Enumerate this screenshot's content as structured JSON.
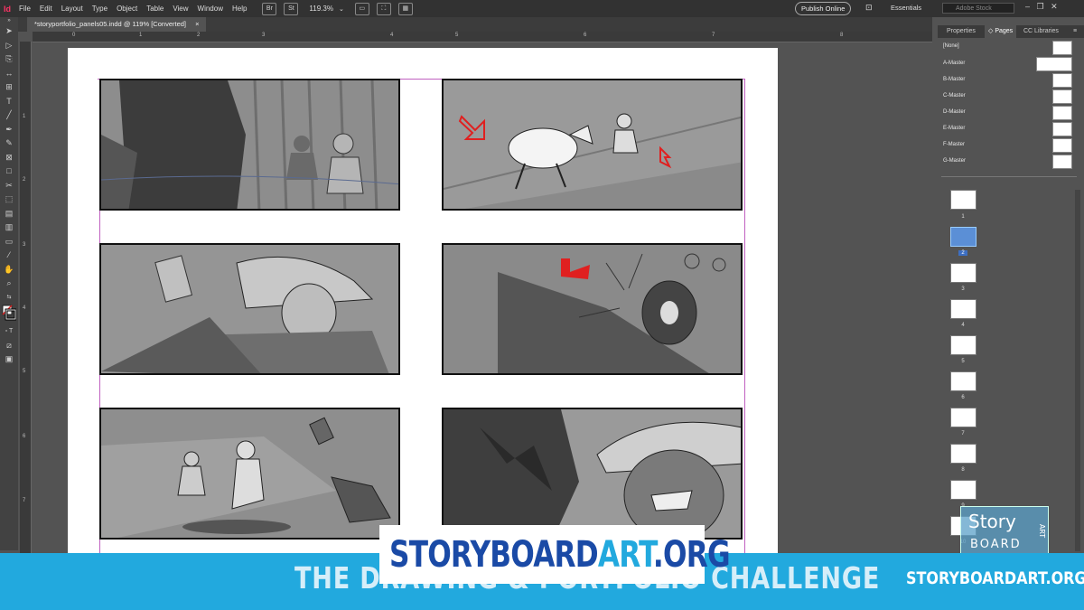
{
  "app": {
    "logo": "Id",
    "menu": [
      "File",
      "Edit",
      "Layout",
      "Type",
      "Object",
      "Table",
      "View",
      "Window",
      "Help"
    ],
    "bridge_icons": [
      "Br",
      "St"
    ],
    "zoom": "119.3%",
    "publish": "Publish Online",
    "workspace": "Essentials",
    "search_placeholder": "Adobe Stock"
  },
  "document": {
    "tab_title": "*storyportfolio_panels05.indd @ 119% [Converted]",
    "close": "×"
  },
  "rulers": {
    "h": [
      "0",
      "1",
      "2",
      "3",
      "4",
      "5",
      "6",
      "7",
      "8"
    ],
    "v": [
      "1",
      "2",
      "3",
      "4",
      "5",
      "6",
      "7"
    ]
  },
  "panels": {
    "tabs": [
      "Properties",
      "Pages",
      "CC Libraries"
    ],
    "active_tab": "Pages",
    "masters": [
      "[None]",
      "A-Master",
      "B-Master",
      "C-Master",
      "D-Master",
      "E-Master",
      "F-Master",
      "G-Master"
    ],
    "pages": [
      "1",
      "2",
      "3",
      "4",
      "5",
      "6",
      "7",
      "8",
      "9",
      "10"
    ],
    "selected_page": "2"
  },
  "banner": {
    "logo_story": "STORYBOARD",
    "logo_art": "ART",
    "logo_org": ".ORG",
    "title": "THE DRAWING & PORTFOLIO CHALLENGE",
    "url": "STORYBOARDART.ORG",
    "corner_logo_story": "Story",
    "corner_logo_board": "BOARD",
    "corner_logo_art": "ART"
  },
  "colors": {
    "accent": "#22a9de",
    "logo_blue": "#1a4aa6",
    "indesign_pink": "#ff3366",
    "guide": "#c060c0"
  }
}
